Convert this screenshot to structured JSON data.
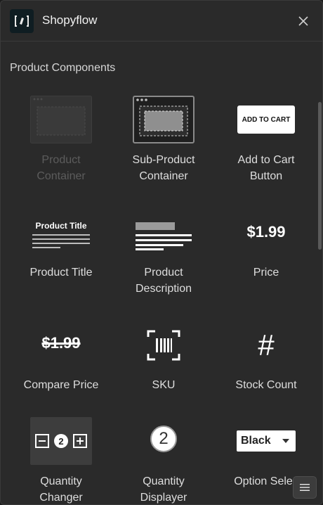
{
  "header": {
    "title": "Shopyflow",
    "logo_glyph": "[⁘]"
  },
  "section": {
    "title": "Product Components"
  },
  "components": [
    {
      "label_1": "Product",
      "label_2": "Container",
      "disabled": true
    },
    {
      "label_1": "Sub-Product",
      "label_2": "Container"
    },
    {
      "label_1": "Add to Cart",
      "label_2": "Button",
      "thumb_text": "ADD TO CART"
    },
    {
      "label_1": "Product Title",
      "thumb_text": "Product Title"
    },
    {
      "label_1": "Product",
      "label_2": "Description"
    },
    {
      "label_1": "Price",
      "thumb_text": "$1.99"
    },
    {
      "label_1": "Compare Price",
      "thumb_text": "$1.99"
    },
    {
      "label_1": "SKU"
    },
    {
      "label_1": "Stock Count",
      "thumb_text": "#"
    },
    {
      "label_1": "Quantity",
      "label_2": "Changer",
      "thumb_text": "2"
    },
    {
      "label_1": "Quantity",
      "label_2": "Displayer",
      "thumb_text": "2"
    },
    {
      "label_1": "Option Selec",
      "thumb_text": "Black"
    }
  ],
  "colors": {
    "panel_bg": "#2a2a2a",
    "text": "#dedede",
    "disabled_text": "#5c5c5c",
    "thumb_white": "#ffffff"
  }
}
